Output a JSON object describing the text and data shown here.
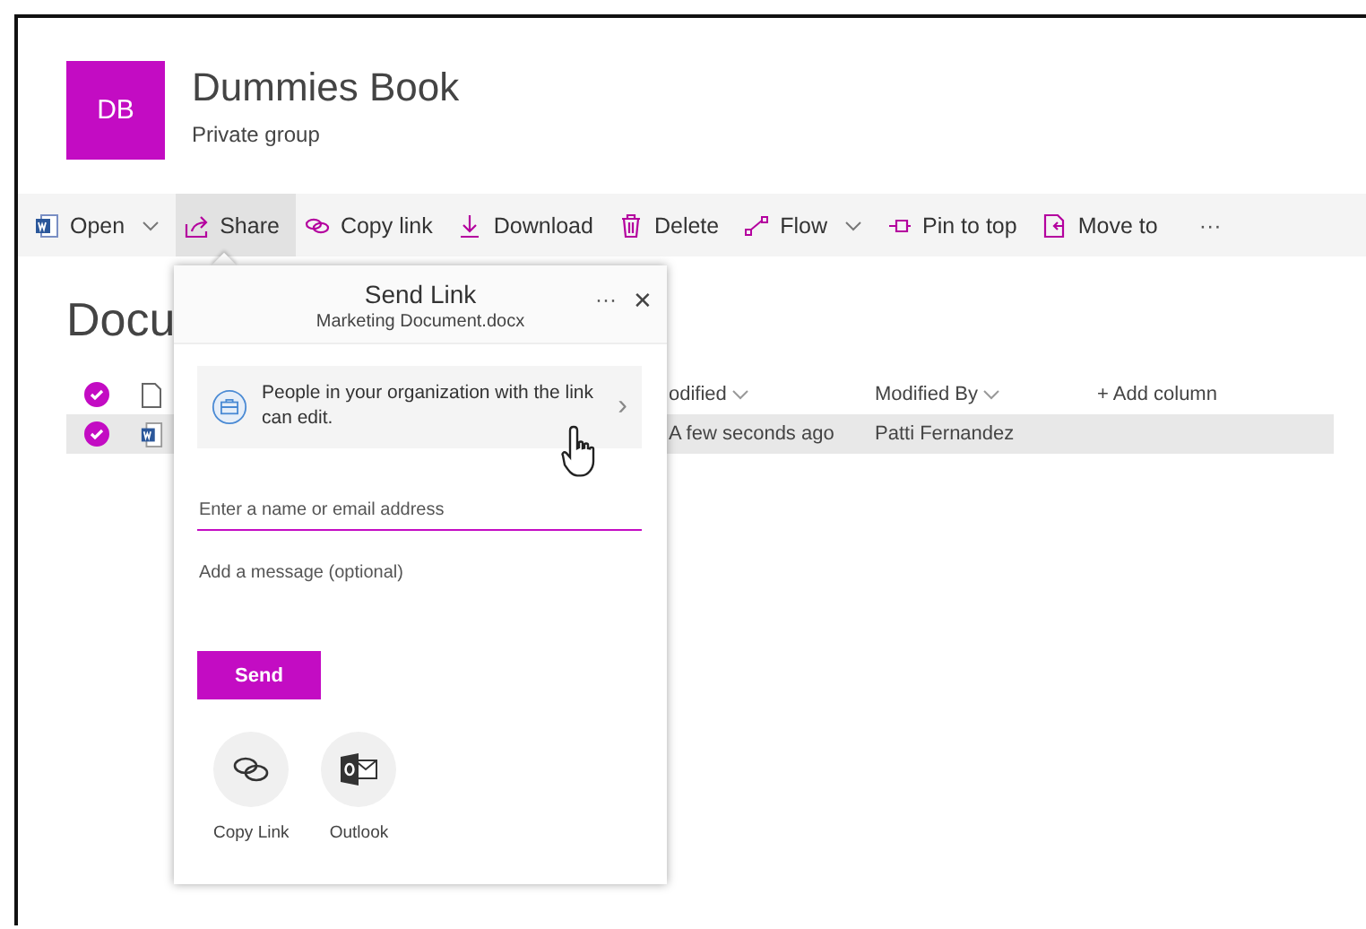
{
  "group": {
    "initials": "DB",
    "name": "Dummies Book",
    "privacy": "Private group"
  },
  "toolbar": [
    {
      "label": "Open",
      "dropdown": true,
      "selected": false
    },
    {
      "label": "Share",
      "dropdown": false,
      "selected": true
    },
    {
      "label": "Copy link",
      "dropdown": false,
      "selected": false
    },
    {
      "label": "Download",
      "dropdown": false,
      "selected": false
    },
    {
      "label": "Delete",
      "dropdown": false,
      "selected": false
    },
    {
      "label": "Flow",
      "dropdown": true,
      "selected": false
    },
    {
      "label": "Pin to top",
      "dropdown": false,
      "selected": false
    },
    {
      "label": "Move to",
      "dropdown": false,
      "selected": false
    }
  ],
  "more": "···",
  "library": {
    "title": "Docu",
    "all_checked": true,
    "columns": [
      {
        "label": "odified",
        "sortable": true
      },
      {
        "label": "Modified By",
        "sortable": true
      },
      {
        "label": "+ Add column",
        "sortable": false
      }
    ],
    "rows": [
      {
        "checked": true,
        "selected": true,
        "modified": "A few seconds ago",
        "modified_by": "Patti Fernandez"
      }
    ]
  },
  "dialog": {
    "title": "Send Link",
    "file": "Marketing Document.docx",
    "more": "···",
    "close": "✕",
    "link_setting": "People in your organization with the link can edit.",
    "chevron": "›",
    "recipient": {
      "placeholder": "Enter a name or email address"
    },
    "message": {
      "placeholder": "Add a message (optional)"
    },
    "send": "Send",
    "options": [
      {
        "label": "Copy Link",
        "kind": "link"
      },
      {
        "label": "Outlook",
        "kind": "outlook"
      }
    ]
  }
}
